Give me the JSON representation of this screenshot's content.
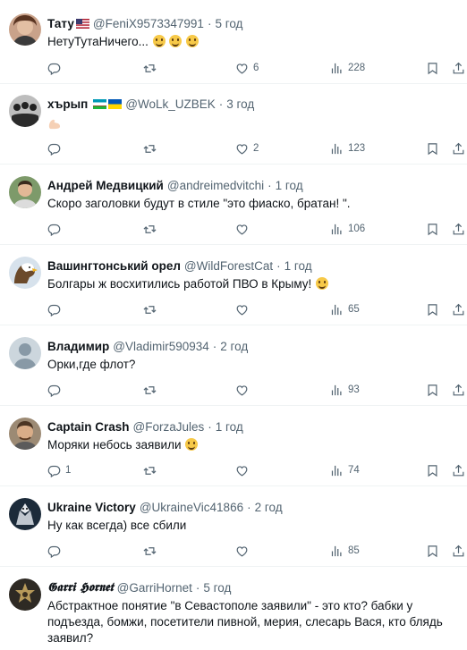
{
  "tweets": [
    {
      "name": "Тату",
      "handle": "@FeniX9573347991",
      "time": "5 год",
      "text": "НетуТутаНичего...",
      "replies": "",
      "likes": "6",
      "views": "228"
    },
    {
      "name": "хърып",
      "handle": "@WoLk_UZBEK",
      "time": "3 год",
      "text": "",
      "replies": "",
      "likes": "2",
      "views": "123"
    },
    {
      "name": "Андрей Медвицкий",
      "handle": "@andreimedvitchi",
      "time": "1 год",
      "text": "Скоро заголовки будут в стиле \"это фиаско, братан! \".",
      "replies": "",
      "likes": "",
      "views": "106"
    },
    {
      "name": "Вашингтонський орел",
      "handle": "@WildForestCat",
      "time": "1 год",
      "text": "Болгары ж восхитились работой ПВО в Крыму!",
      "replies": "",
      "likes": "",
      "views": "65"
    },
    {
      "name": "Владимир",
      "handle": "@Vladimir590934",
      "time": "2 год",
      "text": "Орки,где флот?",
      "replies": "",
      "likes": "",
      "views": "93"
    },
    {
      "name": "Captain Crash",
      "handle": "@ForzaJules",
      "time": "1 год",
      "text": "Моряки небось заявили",
      "replies": "1",
      "likes": "",
      "views": "74"
    },
    {
      "name": "Ukraine Victory",
      "handle": "@UkraineVic41866",
      "time": "2 год",
      "text": "Ну как всегда) все сбили",
      "replies": "",
      "likes": "",
      "views": "85"
    },
    {
      "name": "𝕲𝖆𝖗𝖗𝖎 𝕳𝖔𝖗𝖓𝖊𝖙",
      "handle": "@GarriHornet",
      "time": "5 год",
      "text": "Абстрактное понятие \"в Севастополе заявили\" - это кто? бабки у подъезда, бомжи, посетители пивной, мерия, слесарь Вася, кто блядь заявил?",
      "replies": "",
      "likes": "",
      "views": ""
    }
  ],
  "colors": {
    "text": "#0f1419",
    "muted": "#536471",
    "divider": "#eff3f4"
  },
  "icons": [
    "reply-icon",
    "retweet-icon",
    "like-icon",
    "views-icon",
    "bookmark-icon",
    "share-icon"
  ]
}
